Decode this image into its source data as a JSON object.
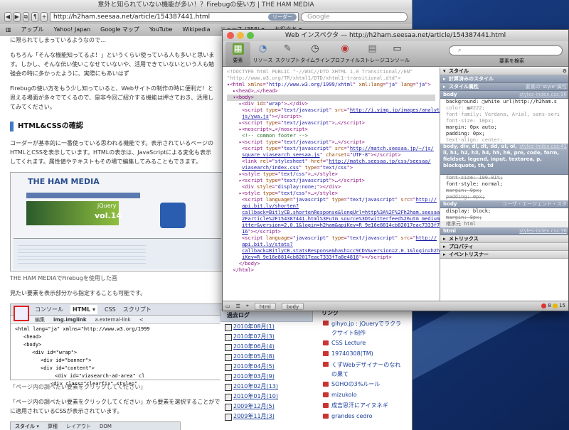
{
  "browser": {
    "title": "意外と知られていない機能が多い！？Firebugの使い方 | THE HAM MEDIA",
    "url": "http://h2ham.seesaa.net/article/154387441.html",
    "reload_label": "リーダー",
    "search_placeholder": "Google",
    "bookmarks": [
      "アップル",
      "Yahoo! Japan",
      "Google マップ",
      "YouTube",
      "Wikipedia",
      "ニュース (358) ▾",
      "お役立ち ▾"
    ]
  },
  "article": {
    "p1": "に限られてしまっているようなので…",
    "p2": "もちろん「そんな機能知ってるよ！」というくらい使っている人も多いと思います。しかし、そんな伝い使いこなせていないや、活用できていないという人も勉強会の時に多かったように、実際にもあいはず",
    "p3": "Firebugの使い方をもう少し知っていると、Webサイトの制作の時に便利だ！と思える場面が多々でてくるので、是非今回ご紹介する機能は押さておき、活用してみてください。",
    "h2": "HTML&CSSの確認",
    "p4": "コーダーが基本的に一番使っている思われる機能です。表示されているページのHTMLとCSSを表示しています。HTMLの表示は、JavaScriptによる変化も表示してくれます。属性値やテキストもその場で編集してみることもできます。",
    "shot1_header": "THE HAM MEDIA",
    "shot1_badge": "vol.14",
    "shot1_jquery": "jQuery",
    "cap1": "THE HAM MEDIAでFirebugを使用した画",
    "p5": "見たい要素を表示部分から指定することも可能です。",
    "fb_tabs": [
      "コンソール",
      "HTML ▾",
      "CSS",
      "スクリプト"
    ],
    "fb_sub": [
      "編集",
      "img.imglink",
      "a.external-link",
      "<"
    ],
    "fb_lines": [
      "<html lang=\"ja\" xmlns=\"http://www.w3.org/1999",
      "<head>",
      "<body>",
      "<div id=\"wrap\">",
      "<div id=\"banner\">",
      "<div id=\"content\">",
      "<div id=\"viasearch-ad-area\" cl",
      "<div class=\"clearfix\" style=\""
    ],
    "cap2": "「ページ内の調べたい要素をクリックしてください」",
    "p6": "「ページ内の調べたい要素をクリックしてください」から要素を選択することができます。選択した要素はHTMLだけでなく、Firebugの右側にはその要素に適用されているCSSが表示されています。",
    "bottom_tabs": [
      "スタイル ▾",
      "算種",
      "レイアウト",
      "DOM"
    ]
  },
  "right": {
    "links_label": "リンク",
    "archive_title": "過去ログ",
    "archives": [
      "2010年08月(1)",
      "2010年07月(3)",
      "2010年06月(4)",
      "2010年05月(8)",
      "2010年04月(5)",
      "2010年03月(9)",
      "2010年02月(13)",
      "2010年01月(10)",
      "2009年12月(5)",
      "2009年11月(3)"
    ],
    "links": [
      "gihyo.jp : jQueryでラクラクサイト制作",
      "CSS Lecture",
      "19740308(TM)",
      "くずWebデザイナーのなれの果て",
      "SOHOの3%ルール",
      "mizukolo",
      "成吉思汗にアイヌネギ",
      "grandes cedro"
    ]
  },
  "inspector": {
    "title": "Web インスペクタ — http://h2ham.seesaa.net/article/154387441.html",
    "toolbar": [
      {
        "label": "要素",
        "icon": "elements-icon"
      },
      {
        "label": "リソース",
        "icon": "resources-icon"
      },
      {
        "label": "スクリプト",
        "icon": "scripts-icon"
      },
      {
        "label": "タイムライン",
        "icon": "timeline-icon"
      },
      {
        "label": "プロファイル",
        "icon": "profiles-icon"
      },
      {
        "label": "ストレージ",
        "icon": "storage-icon"
      },
      {
        "label": "コンソール",
        "icon": "console-icon"
      }
    ],
    "search_label": "要素を検索",
    "breadcrumbs": [
      "html",
      "body"
    ],
    "errors": "8",
    "warnings": "15",
    "sidebar": {
      "style_header": "スタイル",
      "computed_header": "計算済みのスタイル",
      "attr_header": "スタイル属性",
      "attr_right": "要素の\"style\"属性",
      "rule1_sel": "body",
      "rule1_src": "styles-index.css:96",
      "rule1_props": [
        "background: ▢white url(http://h2ham.s",
        "color: ■#222;",
        "font-family: Verdana, Arial, sans-seri",
        "font-size: 10px;",
        "margin: 0px auto;",
        "padding: 0px;",
        "text-align: center;"
      ],
      "rule2_sel": "body, div, dl, dt, dd, ul, ol, li, h1, h2, h3, h4, h5, h6, pre, code, form, fieldset, legend, input, textarea, p, blockquote, th, td",
      "rule2_src": "styles-index.css:41",
      "rule2_props": [
        "font-size: 100.01%;",
        "font-style: normal;",
        "margin: 0px;",
        "padding: 0px;"
      ],
      "rule3_sel": "body",
      "rule3_src": "ユーザ・エージェント・スタ",
      "rule3_props": [
        "display: block;",
        "margin: 8px;"
      ],
      "inherit": "継承元 html",
      "rule4_sel": "html",
      "rule4_src": "styles-index.css:36",
      "metrics": "メトリックス",
      "properties": "プロパティ",
      "listeners": "イベントリスナー"
    }
  }
}
